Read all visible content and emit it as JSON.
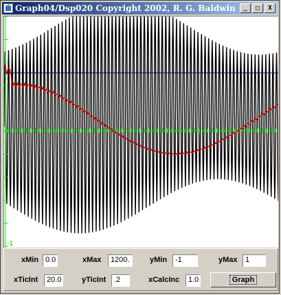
{
  "window": {
    "title": "Graph04/Dsp020 Copyright 2002, R. G. Baldwin",
    "buttons": {
      "minimize": "_",
      "maximize": "□",
      "close": "X"
    }
  },
  "plot": {
    "y_top_label": "",
    "y_bottom_label": "-1",
    "colors": {
      "background": "#ffffff",
      "axis": "#00ff00",
      "signal": "#000000",
      "smooth": "#cc0000",
      "level": "#000080"
    }
  },
  "controls": {
    "xMin": {
      "label": "xMin",
      "value": "0.0"
    },
    "xMax": {
      "label": "xMax",
      "value": "1200."
    },
    "yMin": {
      "label": "yMin",
      "value": "-1"
    },
    "yMax": {
      "label": "yMax",
      "value": "1"
    },
    "xTicInt": {
      "label": "xTicInt",
      "value": "20.0"
    },
    "yTicInt": {
      "label": "yTicInt",
      "value": ".2"
    },
    "xCalcInc": {
      "label": "xCalcInc",
      "value": "1.0"
    },
    "graph_button": "Graph"
  }
}
